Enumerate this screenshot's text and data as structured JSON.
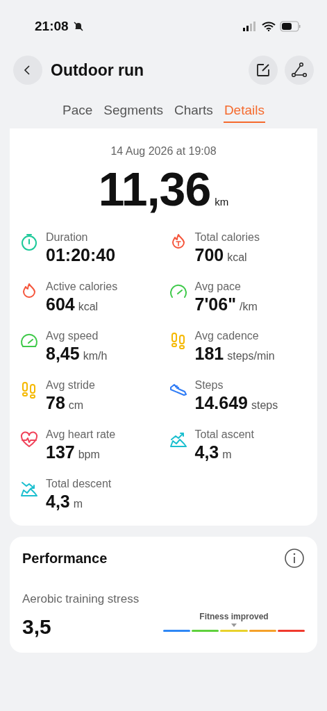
{
  "status_bar": {
    "time": "21:08"
  },
  "header": {
    "title": "Outdoor run"
  },
  "tabs": [
    {
      "label": "Pace",
      "selected": false
    },
    {
      "label": "Segments",
      "selected": false
    },
    {
      "label": "Charts",
      "selected": false
    },
    {
      "label": "Details",
      "selected": true
    }
  ],
  "summary": {
    "date": "14 Aug 2026 at 19:08",
    "distance": "11,36",
    "unit": "km"
  },
  "metrics": [
    {
      "kind": "timer",
      "label": "Duration",
      "value": "01:20:40"
    },
    {
      "kind": "total-calories",
      "label": "Total calories",
      "value": "700",
      "unit": "kcal"
    },
    {
      "kind": "flame",
      "label": "Active calories",
      "value": "604",
      "unit": "kcal"
    },
    {
      "kind": "pace",
      "label": "Avg pace",
      "value": "7'06\"",
      "unit": "/km"
    },
    {
      "kind": "speed",
      "label": "Avg speed",
      "value": "8,45",
      "unit": "km/h"
    },
    {
      "kind": "footprints",
      "label": "Avg cadence",
      "value": "181",
      "unit": "steps/min"
    },
    {
      "kind": "footprints",
      "label": "Avg stride",
      "value": "78",
      "unit": "cm"
    },
    {
      "kind": "shoe",
      "label": "Steps",
      "value": "14.649",
      "unit": "steps"
    },
    {
      "kind": "heart",
      "label": "Avg heart rate",
      "value": "137",
      "unit": "bpm"
    },
    {
      "kind": "ascent",
      "label": "Total ascent",
      "value": "4,3",
      "unit": "m"
    },
    {
      "kind": "descent",
      "label": "Total descent",
      "value": "4,3",
      "unit": "m"
    }
  ],
  "performance": {
    "title": "Performance",
    "metric_label": "Aerobic training stress",
    "metric_value": "3,5",
    "scale_label": "Fitness improved",
    "level": 0.5
  }
}
